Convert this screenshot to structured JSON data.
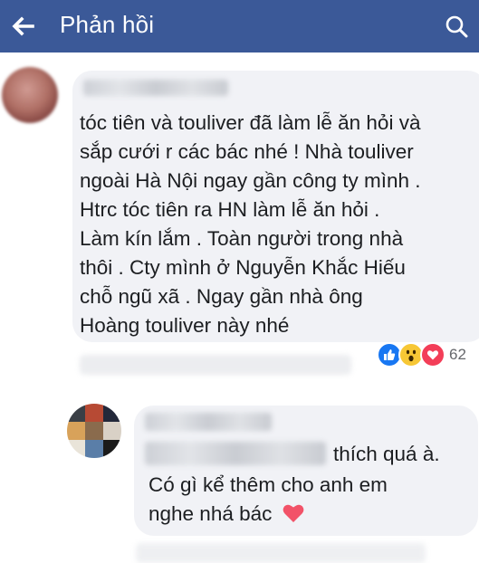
{
  "header": {
    "title": "Phản hồi",
    "bg_color": "#3b5998",
    "back_icon": "back-arrow-icon",
    "search_icon": "search-icon"
  },
  "main_comment": {
    "lines": [
      "tóc tiên và touliver đã làm lễ ăn hỏi và",
      "sắp cưới r các bác nhé ! Nhà touliver",
      "ngoài Hà Nội ngay gần công ty mình .",
      "Htrc tóc tiên ra HN làm lễ ăn hỏi .",
      "Làm kín lắm . Toàn người trong nhà",
      "thôi . Cty mình ở Nguyễn Khắc Hiếu",
      "chỗ ngũ xã . Ngay gần nhà ông",
      "Hoàng touliver này nhé"
    ],
    "reactions": {
      "icons": [
        "like-reaction-icon",
        "wow-reaction-icon",
        "love-reaction-icon"
      ],
      "count": "62"
    }
  },
  "reply": {
    "line1_visible": "thích quá à.",
    "line2": "Có gì kể thêm cho anh em",
    "line3": "nghe nhá bác",
    "emoji_icon": "heart-emoji-icon"
  }
}
